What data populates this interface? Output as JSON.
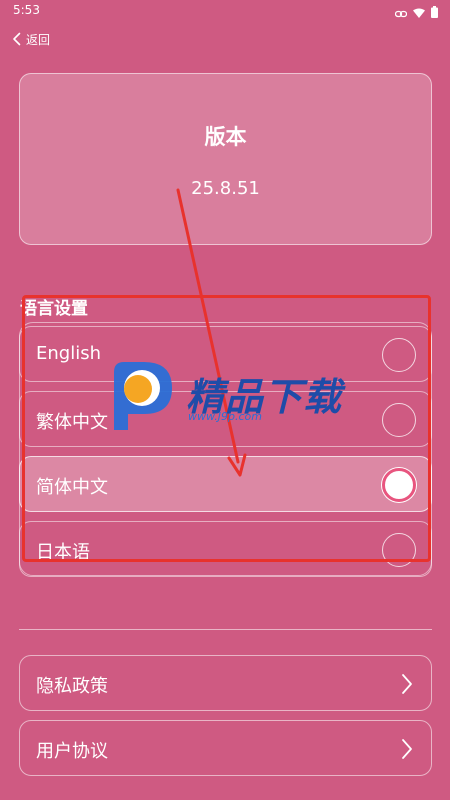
{
  "status_bar": {
    "time": "5:53"
  },
  "nav": {
    "back_label": "返回"
  },
  "version": {
    "title": "版本",
    "value": "25.8.51"
  },
  "language": {
    "heading": "语言设置",
    "options": [
      {
        "label": "English",
        "selected": false
      },
      {
        "label": "繁体中文",
        "selected": false
      },
      {
        "label": "简体中文",
        "selected": true
      },
      {
        "label": "日本语",
        "selected": false
      }
    ]
  },
  "links": [
    {
      "label": "隐私政策"
    },
    {
      "label": "用户协议"
    }
  ],
  "watermark": {
    "title": "精品下载",
    "subtitle": "www.J9p.com"
  },
  "colors": {
    "background": "#cf5a82",
    "annotation": "#e8322d",
    "radio_selected_ring": "#e8557f"
  }
}
